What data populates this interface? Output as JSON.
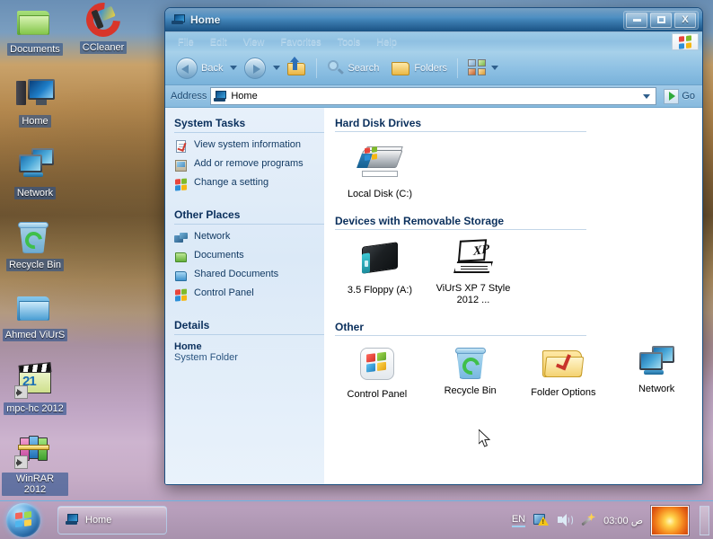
{
  "desktop": {
    "icons": [
      {
        "label": "Documents",
        "icon": "folder-green-icon",
        "shortcut": false
      },
      {
        "label": "CCleaner",
        "icon": "ccleaner-icon",
        "shortcut": false
      },
      {
        "label": "Home",
        "icon": "my-computer-icon",
        "shortcut": false
      },
      {
        "label": "Network",
        "icon": "network-icon",
        "shortcut": false
      },
      {
        "label": "Recycle Bin",
        "icon": "recycle-bin-icon",
        "shortcut": false
      },
      {
        "label": "Ahmed ViUrS",
        "icon": "folder-blue-icon",
        "shortcut": false
      },
      {
        "label": "mpc-hc 2012",
        "icon": "media-player-icon",
        "shortcut": true
      },
      {
        "label": "WinRAR 2012",
        "icon": "winrar-icon",
        "shortcut": true
      }
    ]
  },
  "window": {
    "title": "Home",
    "buttons": {
      "minimize": "minimize-button",
      "maximize": "maximize-button",
      "close": "X"
    },
    "menu": [
      "File",
      "Edit",
      "View",
      "Favorites",
      "Tools",
      "Help"
    ],
    "toolbar": {
      "back": "Back",
      "forward": "",
      "up": "",
      "search": "Search",
      "folders": "Folders",
      "views": ""
    },
    "address": {
      "label": "Address",
      "value": "Home",
      "go": "Go"
    },
    "sidebar": {
      "system_tasks": {
        "heading": "System Tasks",
        "items": [
          {
            "label": "View system information",
            "icon": "system-info-icon"
          },
          {
            "label": "Add or remove programs",
            "icon": "add-remove-programs-icon"
          },
          {
            "label": "Change a setting",
            "icon": "windows-flag-icon"
          }
        ]
      },
      "other_places": {
        "heading": "Other Places",
        "items": [
          {
            "label": "Network",
            "icon": "network-icon"
          },
          {
            "label": "Documents",
            "icon": "folder-green-icon"
          },
          {
            "label": "Shared Documents",
            "icon": "folder-blue-icon"
          },
          {
            "label": "Control Panel",
            "icon": "windows-flag-icon"
          }
        ]
      },
      "details": {
        "heading": "Details",
        "name": "Home",
        "type": "System Folder"
      }
    },
    "content": {
      "groups": [
        {
          "heading": "Hard Disk Drives",
          "items": [
            {
              "label": "Local Disk (C:)",
              "icon": "hard-disk-icon"
            }
          ]
        },
        {
          "heading": "Devices with Removable Storage",
          "items": [
            {
              "label": "3.5 Floppy (A:)",
              "icon": "floppy-drive-icon"
            },
            {
              "label": "ViUrS XP 7 Style 2012 ...",
              "icon": "xp-laptop-icon"
            }
          ]
        },
        {
          "heading": "Other",
          "items": [
            {
              "label": "Control Panel",
              "icon": "control-panel-icon"
            },
            {
              "label": "Recycle Bin",
              "icon": "recycle-bin-icon"
            },
            {
              "label": "Folder Options",
              "icon": "folder-options-icon"
            },
            {
              "label": "Network",
              "icon": "network-icon"
            }
          ]
        }
      ]
    }
  },
  "taskbar": {
    "start": "start-orb",
    "tasks": [
      {
        "label": "Home",
        "icon": "my-computer-icon"
      }
    ],
    "tray": {
      "language": "EN",
      "icons": [
        "security-alert-icon",
        "volume-icon",
        "magic-wand-icon"
      ],
      "clock": "03:00 ص"
    }
  },
  "colors": {
    "title_blue": "#3f86bd",
    "taskbar_blue": "#1d5a92",
    "accent": "#2e6fb5"
  }
}
